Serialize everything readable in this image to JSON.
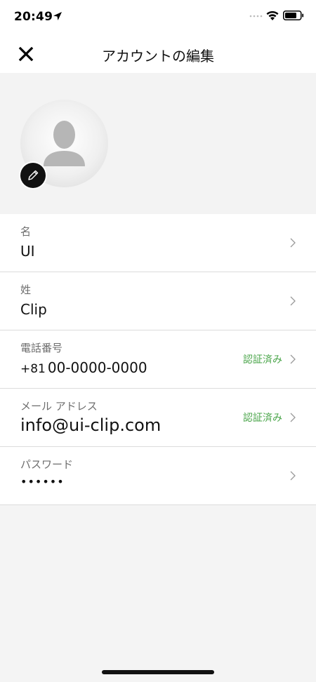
{
  "status_bar": {
    "time": "20:49",
    "icons": [
      "location-arrow-icon",
      "signal-dots-icon",
      "wifi-icon",
      "battery-icon"
    ]
  },
  "nav": {
    "close_icon": "close-icon",
    "title": "アカウントの編集"
  },
  "avatar": {
    "icon": "user-silhouette-icon",
    "edit_icon": "pencil-icon"
  },
  "fields": [
    {
      "label": "名",
      "value": "UI"
    },
    {
      "label": "姓",
      "value": "Clip"
    },
    {
      "label": "電話番号",
      "country_code": "+81",
      "value": "00-0000-0000",
      "badge": "認証済み"
    },
    {
      "label": "メール アドレス",
      "value": "info@ui-clip.com",
      "badge": "認証済み"
    },
    {
      "label": "パスワード",
      "value": "••••••"
    }
  ],
  "colors": {
    "verified": "#4aa54a",
    "background": "#f4f4f4",
    "text": "#111111"
  }
}
